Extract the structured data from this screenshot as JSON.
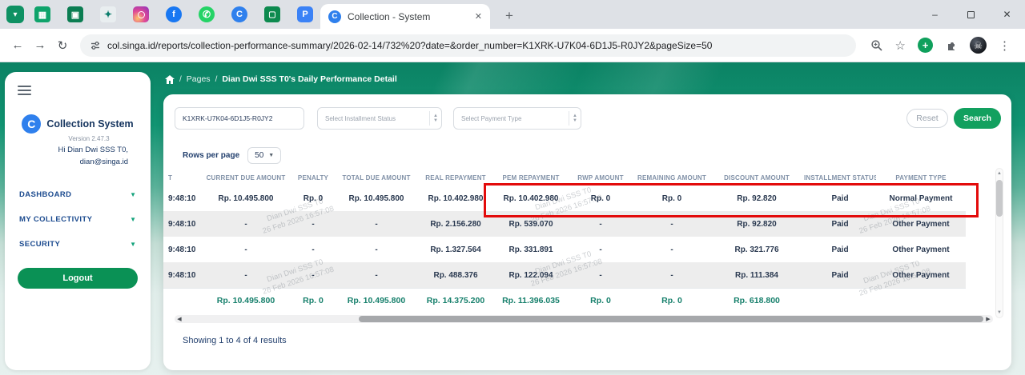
{
  "browser": {
    "active_tab_title": "Collection - System",
    "url": "col.singa.id/reports/collection-performance-summary/2026-02-14/732%20?date=&order_number=K1XRK-U7K04-6D1J5-R0JY2&pageSize=50",
    "pinned_tab_glyphs": {
      "facebook": "f",
      "collection": "C",
      "p_app": "P"
    }
  },
  "sidebar": {
    "logo_letter": "C",
    "app_name": "Collection System",
    "version": "Version 2.47.3",
    "greeting": "Hi Dian Dwi SSS T0,",
    "email": "dian@singa.id",
    "menu": [
      {
        "label": "DASHBOARD"
      },
      {
        "label": "MY COLLECTIVITY"
      },
      {
        "label": "SECURITY"
      }
    ],
    "logout_label": "Logout"
  },
  "breadcrumb": {
    "section": "Pages",
    "separator": "/",
    "current": "Dian Dwi SSS T0's Daily Performance Detail"
  },
  "filters": {
    "order_number_value": "K1XRK-U7K04-6D1J5-R0JY2",
    "installment_status_placeholder": "Select Installment Status",
    "payment_type_placeholder": "Select Payment Type",
    "reset_label": "Reset",
    "search_label": "Search"
  },
  "table": {
    "rows_per_page_label": "Rows per page",
    "rows_per_page_value": "50",
    "columns": [
      "T",
      "CURRENT DUE AMOUNT",
      "PENALTY",
      "TOTAL DUE AMOUNT",
      "REAL REPAYMENT",
      "PEM REPAYMENT",
      "RWP AMOUNT",
      "REMAINING AMOUNT",
      "DISCOUNT AMOUNT",
      "INSTALLMENT STATUS",
      "PAYMENT TYPE"
    ],
    "rows": [
      [
        "9:48:10",
        "Rp. 10.495.800",
        "Rp. 0",
        "Rp. 10.495.800",
        "Rp. 10.402.980",
        "Rp. 10.402.980",
        "Rp. 0",
        "Rp. 0",
        "Rp. 92.820",
        "Paid",
        "Normal Payment"
      ],
      [
        "9:48:10",
        "-",
        "-",
        "-",
        "Rp. 2.156.280",
        "Rp. 539.070",
        "-",
        "-",
        "Rp. 92.820",
        "Paid",
        "Other Payment"
      ],
      [
        "9:48:10",
        "-",
        "-",
        "-",
        "Rp. 1.327.564",
        "Rp. 331.891",
        "-",
        "-",
        "Rp. 321.776",
        "Paid",
        "Other Payment"
      ],
      [
        "9:48:10",
        "-",
        "-",
        "-",
        "Rp. 488.376",
        "Rp. 122.094",
        "-",
        "-",
        "Rp. 111.384",
        "Paid",
        "Other Payment"
      ]
    ],
    "totals": [
      "",
      "Rp. 10.495.800",
      "Rp. 0",
      "Rp. 10.495.800",
      "Rp. 14.375.200",
      "Rp. 11.396.035",
      "Rp. 0",
      "Rp. 0",
      "Rp. 618.800",
      "",
      ""
    ],
    "showing": "Showing 1 to 4 of 4 results"
  },
  "watermark": {
    "line1": "Dian Dwi SSS T0",
    "line2": "26 Feb 2026 16:57:08"
  },
  "colors": {
    "accent_green": "#12a05f",
    "logout_green": "#0a9155",
    "highlight_red": "#e30b0b",
    "totals_teal": "#17806c"
  }
}
